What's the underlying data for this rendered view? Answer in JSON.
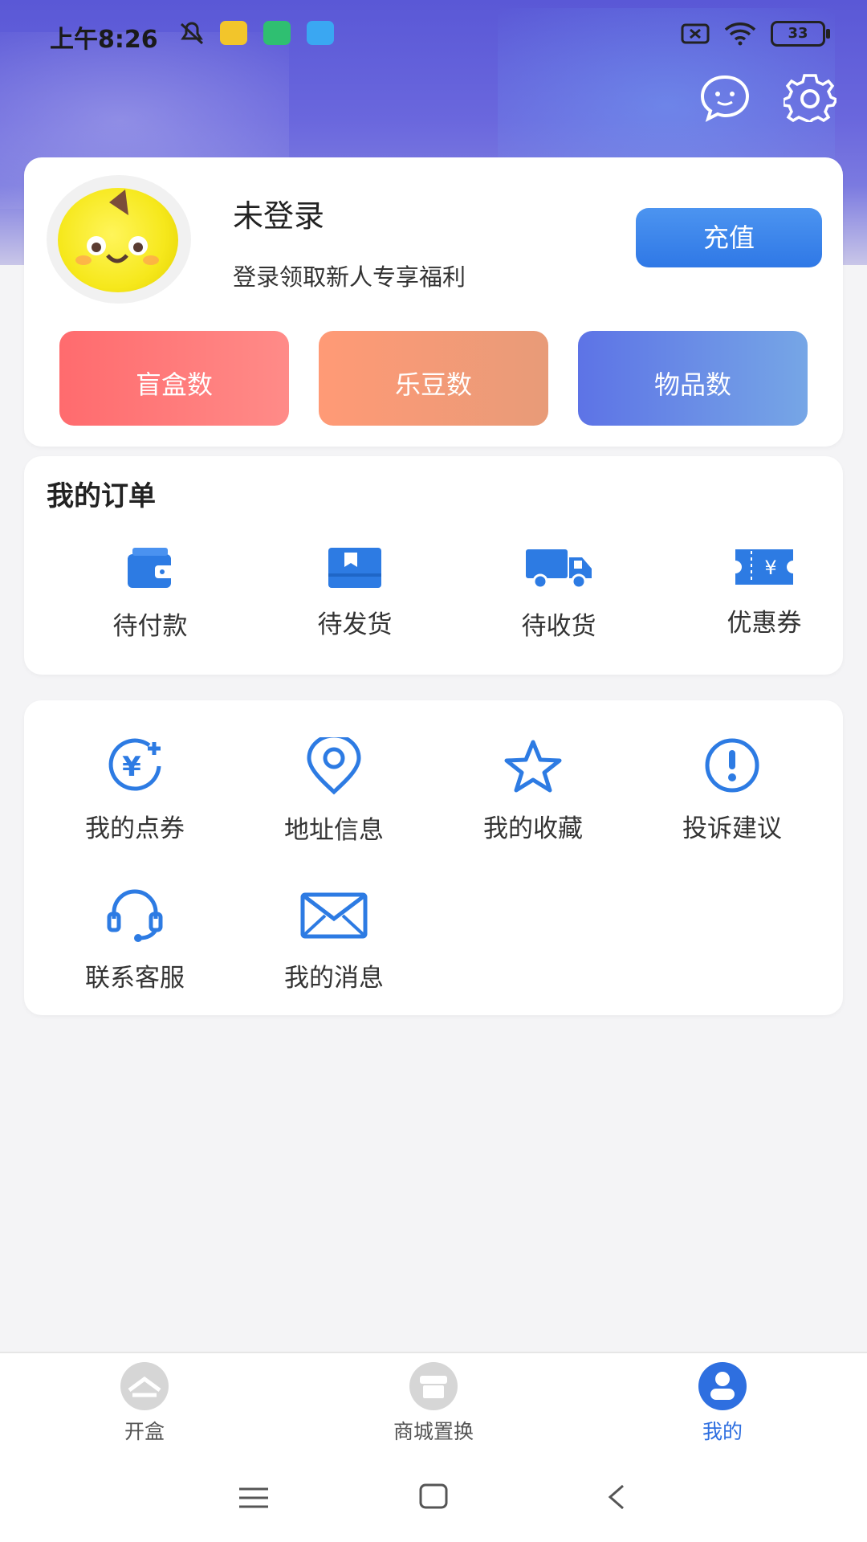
{
  "status_bar": {
    "time": "上午8:26",
    "battery": "33"
  },
  "header": {
    "icons": [
      "chat-bubble-icon",
      "settings-gear-icon"
    ]
  },
  "profile": {
    "name": "未登录",
    "subtitle": "登录领取新人专享福利",
    "recharge_label": "充值",
    "stats": [
      "盲盒数",
      "乐豆数",
      "物品数"
    ]
  },
  "orders": {
    "title": "我的订单",
    "items": [
      {
        "label": "待付款",
        "icon": "wallet-icon"
      },
      {
        "label": "待发货",
        "icon": "box-icon"
      },
      {
        "label": "待收货",
        "icon": "truck-icon"
      },
      {
        "label": "优惠券",
        "icon": "coupon-icon"
      }
    ]
  },
  "tools": {
    "items": [
      {
        "label": "我的点券",
        "icon": "yen-coin-icon"
      },
      {
        "label": "地址信息",
        "icon": "location-pin-icon"
      },
      {
        "label": "我的收藏",
        "icon": "star-icon"
      },
      {
        "label": "投诉建议",
        "icon": "exclamation-icon"
      },
      {
        "label": "联系客服",
        "icon": "headset-icon"
      },
      {
        "label": "我的消息",
        "icon": "envelope-icon"
      }
    ]
  },
  "bottom_nav": {
    "items": [
      {
        "label": "开盒",
        "active": false
      },
      {
        "label": "商城置换",
        "active": false
      },
      {
        "label": "我的",
        "active": true
      }
    ]
  },
  "colors": {
    "accent": "#2f78e6",
    "icon_blue": "#2d7be3"
  }
}
